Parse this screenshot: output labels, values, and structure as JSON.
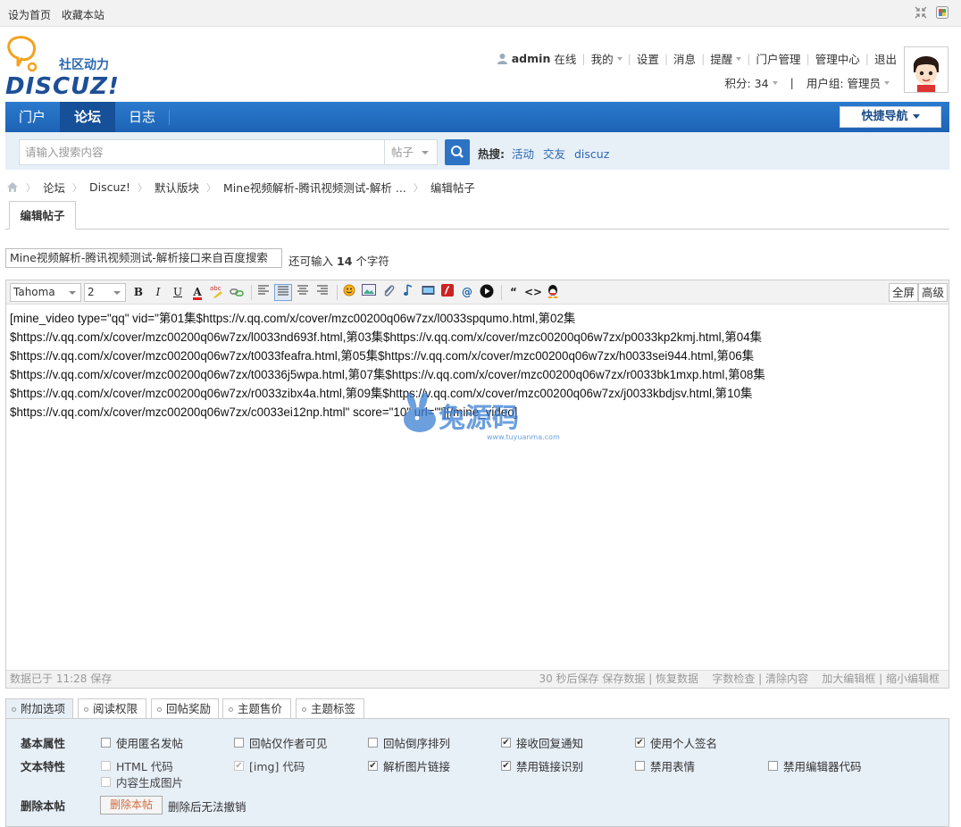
{
  "topbar": {
    "set_home": "设为首页",
    "bookmark": "收藏本站"
  },
  "logo": {
    "tagline": "社区动力",
    "brand": "DISCUZ!"
  },
  "user": {
    "name": "admin",
    "status": "在线",
    "my": "我的",
    "settings": "设置",
    "messages": "消息",
    "reminders": "提醒",
    "portal_manage": "门户管理",
    "admin_center": "管理中心",
    "logout": "退出",
    "points": "积分: 34",
    "group": "用户组: 管理员"
  },
  "nav": {
    "items": [
      "门户",
      "论坛",
      "日志"
    ],
    "quick_nav": "快捷导航"
  },
  "search": {
    "placeholder": "请输入搜索内容",
    "type": "帖子",
    "hot_label": "热搜:",
    "hot": [
      "活动",
      "交友",
      "discuz"
    ]
  },
  "breadcrumb": [
    "论坛",
    "Discuz!",
    "默认版块",
    "Mine视频解析-腾讯视频测试-解析 ...",
    "编辑帖子"
  ],
  "page_tab": "编辑帖子",
  "title_field": {
    "value": "Mine视频解析-腾讯视频测试-解析接口来自百度搜索",
    "remain_prefix": "还可输入",
    "remain_count": "14",
    "remain_suffix": "个字符"
  },
  "toolbar": {
    "font": "Tahoma",
    "size": "2",
    "fullscreen": "全屏",
    "advanced": "高级"
  },
  "editor_lines": [
    "[mine_video type=\"qq\" vid=\"第01集$https://v.qq.com/x/cover/mzc00200q06w7zx/l0033spqumo.html,第02集",
    "$https://v.qq.com/x/cover/mzc00200q06w7zx/l0033nd693f.html,第03集$https://v.qq.com/x/cover/mzc00200q06w7zx/p0033kp2kmj.html,第04集",
    "$https://v.qq.com/x/cover/mzc00200q06w7zx/t0033feafra.html,第05集$https://v.qq.com/x/cover/mzc00200q06w7zx/h0033sei944.html,第06集",
    "$https://v.qq.com/x/cover/mzc00200q06w7zx/t00336j5wpa.html,第07集$https://v.qq.com/x/cover/mzc00200q06w7zx/r0033bk1mxp.html,第08集",
    "$https://v.qq.com/x/cover/mzc00200q06w7zx/r0033zibx4a.html,第09集$https://v.qq.com/x/cover/mzc00200q06w7zx/j0033kbdjsv.html,第10集",
    "$https://v.qq.com/x/cover/mzc00200q06w7zx/c0033ei12np.html\" score=\"10\" url=\"\"][/mine_video]"
  ],
  "watermark": {
    "text": "兔源码",
    "url": "www.tuyuanma.com"
  },
  "status": {
    "saved": "数据已于 11:28 保存",
    "autosave": "30 秒后保存",
    "save_data": "保存数据",
    "restore_data": "恢复数据",
    "word_check": "字数检查",
    "clear": "清除内容",
    "enlarge": "加大编辑框",
    "shrink": "缩小编辑框"
  },
  "option_tabs": [
    "附加选项",
    "阅读权限",
    "回帖奖励",
    "主题售价",
    "主题标签"
  ],
  "options": {
    "basic_label": "基本属性",
    "basic": [
      {
        "label": "使用匿名发帖",
        "checked": false,
        "disabled": false
      },
      {
        "label": "回帖仅作者可见",
        "checked": false,
        "disabled": false
      },
      {
        "label": "回帖倒序排列",
        "checked": false,
        "disabled": false
      },
      {
        "label": "接收回复通知",
        "checked": true,
        "disabled": false
      },
      {
        "label": "使用个人签名",
        "checked": true,
        "disabled": false
      }
    ],
    "text_label": "文本特性",
    "text": [
      {
        "label": "HTML 代码",
        "checked": false,
        "disabled": true
      },
      {
        "label": "[img] 代码",
        "checked": true,
        "disabled": true
      },
      {
        "label": "解析图片链接",
        "checked": true,
        "disabled": false
      },
      {
        "label": "禁用链接识别",
        "checked": true,
        "disabled": false
      },
      {
        "label": "禁用表情",
        "checked": false,
        "disabled": false
      },
      {
        "label": "禁用编辑器代码",
        "checked": false,
        "disabled": false
      },
      {
        "label": "内容生成图片",
        "checked": false,
        "disabled": true
      }
    ],
    "delete_label": "删除本帖",
    "delete_button": "删除本帖",
    "delete_note": "删除后无法撤销"
  }
}
